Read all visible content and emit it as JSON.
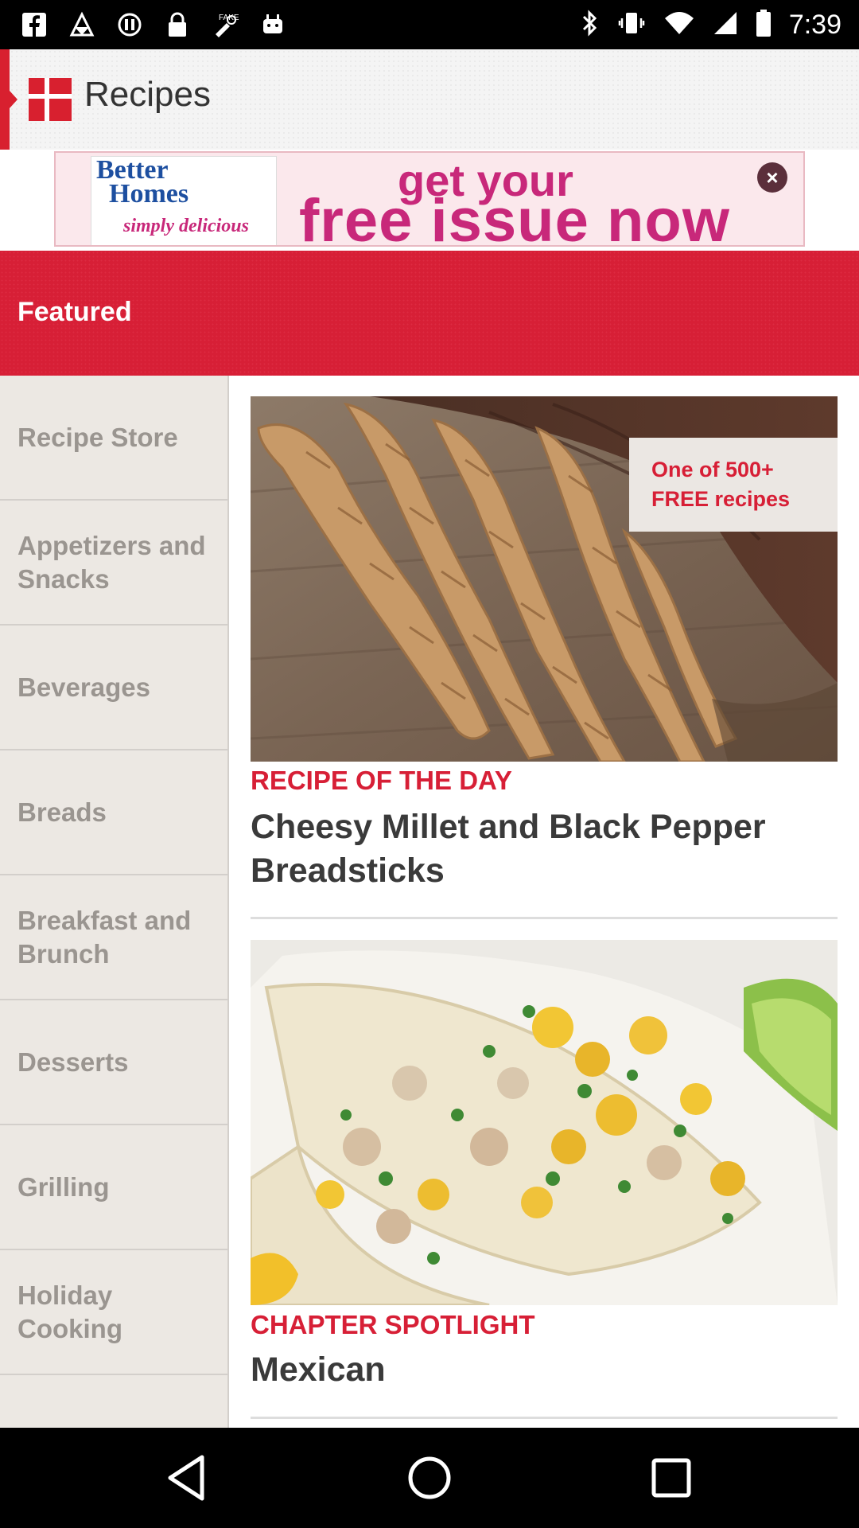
{
  "status_bar": {
    "time": "7:39",
    "left_icons": [
      "facebook-icon",
      "gallery-icon",
      "sync-icon",
      "lock-icon",
      "fake-gps-icon",
      "android-icon"
    ],
    "right_icons": [
      "bluetooth-icon",
      "vibrate-icon",
      "wifi-icon",
      "signal-icon",
      "battery-icon"
    ]
  },
  "app_bar": {
    "title": "Recipes"
  },
  "ad": {
    "magazine_title_line1": "Better",
    "magazine_title_line2": "Homes",
    "magazine_subtitle": "simply delicious",
    "headline_top": "get your",
    "headline_bottom": "free issue now"
  },
  "featured": {
    "label": "Featured"
  },
  "sidebar": {
    "items": [
      {
        "label": "Recipe Store"
      },
      {
        "label": "Appetizers and Snacks"
      },
      {
        "label": "Beverages"
      },
      {
        "label": "Breads"
      },
      {
        "label": "Breakfast and Brunch"
      },
      {
        "label": "Desserts"
      },
      {
        "label": "Grilling"
      },
      {
        "label": "Holiday Cooking"
      }
    ]
  },
  "main": {
    "card1": {
      "promo_line1": "One of 500+",
      "promo_line2": "FREE recipes",
      "kicker": "RECIPE OF THE DAY",
      "title": "Cheesy Millet and Black Pepper Breadsticks"
    },
    "card2": {
      "kicker": "CHAPTER SPOTLIGHT",
      "title": "Mexican"
    }
  },
  "colors": {
    "accent_red": "#d71f36",
    "ad_pink": "#c8287a",
    "sidebar_bg": "#ece8e3"
  }
}
